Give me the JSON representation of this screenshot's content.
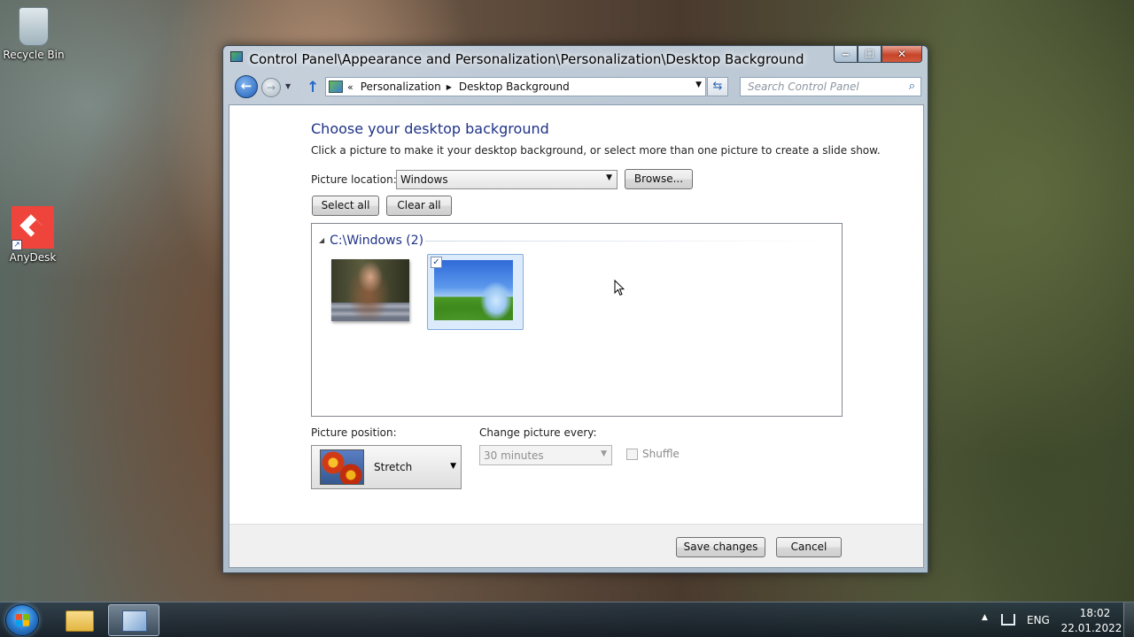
{
  "desktop": {
    "icons": [
      {
        "label": "Recycle Bin",
        "icon": "recycle-bin-icon"
      },
      {
        "label": "AnyDesk",
        "icon": "anydesk-icon"
      }
    ]
  },
  "window": {
    "title": "Control Panel\\Appearance and Personalization\\Personalization\\Desktop Background",
    "controls": {
      "minimize": "‒",
      "maximize": "☐",
      "close": "✕"
    }
  },
  "navbar": {
    "breadcrumb_prefix": "«",
    "breadcrumbs": [
      "Personalization",
      "Desktop Background"
    ],
    "search_placeholder": "Search Control Panel"
  },
  "main": {
    "heading": "Choose your desktop background",
    "description": "Click a picture to make it your desktop background, or select more than one picture to create a slide show.",
    "picture_location_label": "Picture location:",
    "picture_location_value": "Windows",
    "browse_label": "Browse...",
    "select_all_label": "Select all",
    "clear_all_label": "Clear all",
    "group_header": "C:\\Windows (2)",
    "pictures": [
      {
        "selected": false
      },
      {
        "selected": true
      }
    ],
    "picture_position_label": "Picture position:",
    "picture_position_value": "Stretch",
    "change_every_label": "Change picture every:",
    "change_every_value": "30 minutes",
    "shuffle_label": "Shuffle",
    "shuffle_checked": false
  },
  "footer": {
    "save_label": "Save changes",
    "cancel_label": "Cancel"
  },
  "taskbar": {
    "language": "ENG",
    "time": "18:02",
    "date": "22.01.2022"
  },
  "colors": {
    "heading_blue": "#1e3287",
    "selection_bg": "#dcebfc",
    "close_red": "#c7452a"
  }
}
